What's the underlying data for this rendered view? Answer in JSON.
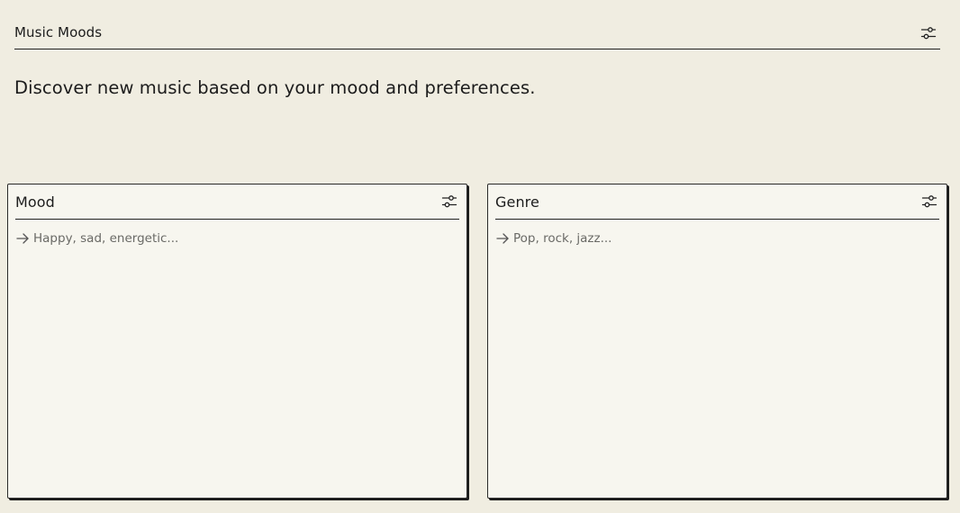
{
  "app": {
    "title": "Music Moods",
    "settings_icon": "sliders-icon"
  },
  "intro": {
    "text": "Discover new music based on your mood and preferences."
  },
  "panels": [
    {
      "title": "Mood",
      "icon": "sliders-icon",
      "input_icon": "arrow-right-icon",
      "placeholder": "Happy, sad, energetic..."
    },
    {
      "title": "Genre",
      "icon": "sliders-icon",
      "input_icon": "arrow-right-icon",
      "placeholder": "Pop, rock, jazz..."
    }
  ],
  "colors": {
    "background": "#f0ede1",
    "panel_background": "#f7f6ef",
    "text": "#1c1c1c",
    "placeholder": "#6a6a66"
  }
}
